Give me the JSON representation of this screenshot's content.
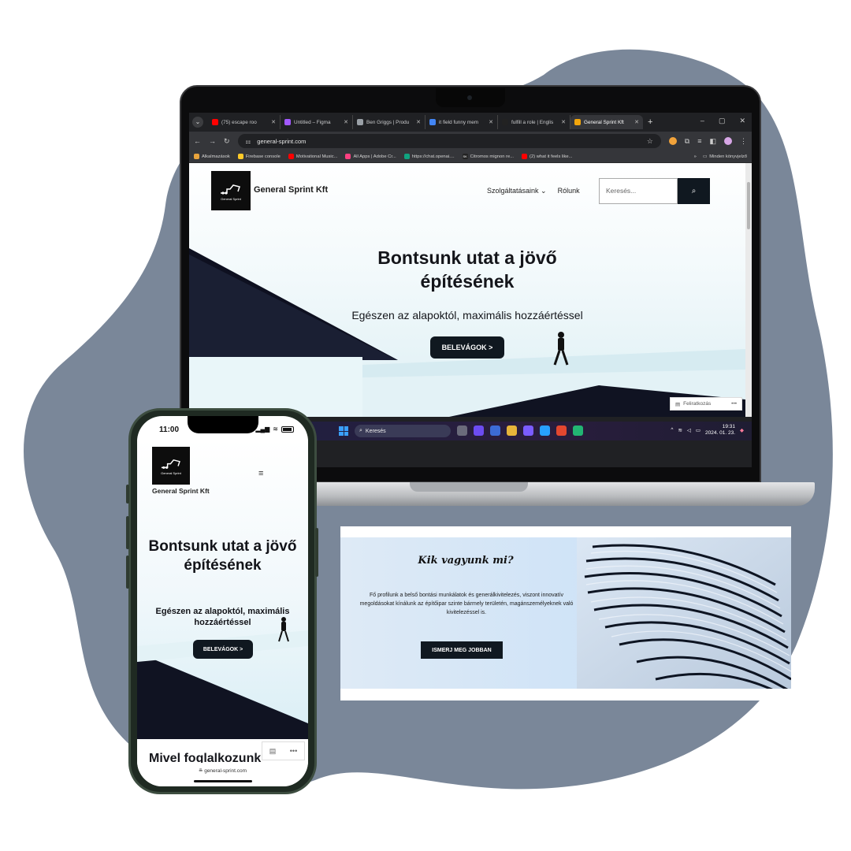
{
  "laptop": {
    "browser": {
      "tabs": [
        {
          "label": "(75) escape roo",
          "color": "#ff0000"
        },
        {
          "label": "Untitled – Figma",
          "color": "#a259ff"
        },
        {
          "label": "Ben Griggs | Produ",
          "color": "#9aa0a6"
        },
        {
          "label": "it field funny mem",
          "color": "#4285f4"
        },
        {
          "label": "fulfill a role | Englis",
          "color": "#222222"
        },
        {
          "label": "General Sprint Kft",
          "color": "#f2a60c"
        }
      ],
      "new_tab": "+",
      "win_controls": [
        "–",
        "▢",
        "✕"
      ],
      "url": "general-sprint.com",
      "bookmarks": [
        {
          "label": "Alkalmazások",
          "color": "#e8a33c"
        },
        {
          "label": "Firebase console",
          "color": "#ffca28"
        },
        {
          "label": "Motivational Music...",
          "color": "#ff0000"
        },
        {
          "label": "All Apps | Adobe Cr...",
          "color": "#ff4081"
        },
        {
          "label": "https://chat.openai....",
          "color": "#10a37f"
        },
        {
          "label": "Citromos mignon re...",
          "color": "#222222",
          "glyph": "SK"
        },
        {
          "label": "(2) what it feels like...",
          "color": "#ff0000"
        }
      ],
      "bookmarks_more": "»",
      "bookmarks_folder": "Minden könyvjelző"
    },
    "site": {
      "logo_text": "General Sprint",
      "brand": "General Sprint Kft",
      "nav": [
        "Szolgáltatásaink ⌄",
        "Rólunk"
      ],
      "search_placeholder": "Keresés...",
      "search_icon": "⌕",
      "hero_title_line1": "Bontsunk utat a jövő",
      "hero_title_line2": "építésének",
      "hero_subtitle": "Egészen az alapoktól, maximális hozzáértéssel",
      "cta": "BELEVÁGOK >",
      "subscribe": "Feliratkozás",
      "subscribe_more": "•••"
    },
    "taskbar": {
      "search_label": "Keresés",
      "app_colors": [
        "#6b6b7b",
        "#6c4cf1",
        "#3c6bd6",
        "#e8b43a",
        "#7b5cff",
        "#27a0ff",
        "#e3472f",
        "#22b573"
      ],
      "tray_up": "^",
      "time": "19:31",
      "date": "2024. 01. 23."
    }
  },
  "about": {
    "title": "Kik vagyunk mi?",
    "text": "Fő profilunk a belső bontási munkálatok és generálkivitelezés, viszont innovatív megoldásokat kínálunk az építőipar szinte bármely területén, magánszemélyeknek való kivitelezéssel is.",
    "cta": "ISMERJ MEG JOBBAN"
  },
  "phone": {
    "time": "11:00",
    "signal": "▂▄▆",
    "wifi": "≋",
    "logo_text": "General Sprint",
    "brand": "General Sprint Kft",
    "menu_icon": "≡",
    "hero_title": "Bontsunk utat a jövő építésének",
    "hero_subtitle": "Egészen az alapoktól, maximális hozzáértéssel",
    "cta": "BELEVÁGOK >",
    "section_title": "Mivel foglalkozunk",
    "float_icon": "▤",
    "float_more": "•••",
    "url": "≞ general-sprint.com"
  },
  "colors": {
    "blob": "#7a8799",
    "dark_button": "#101820"
  }
}
